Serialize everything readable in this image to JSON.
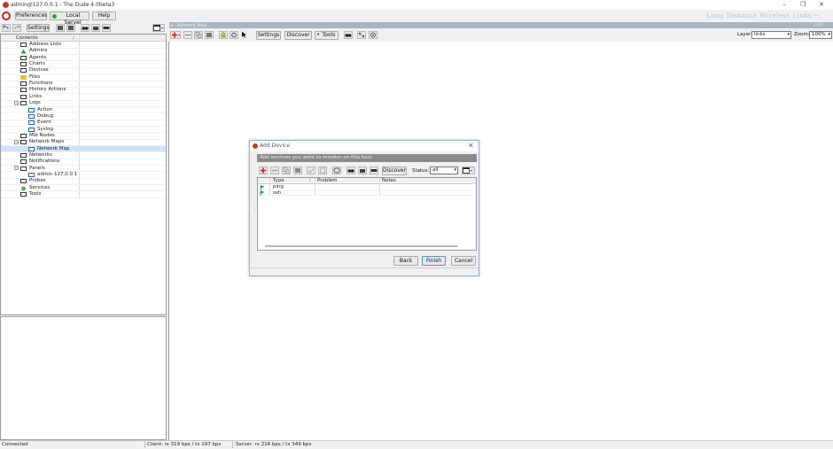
{
  "window": {
    "title": "admin@127.0.0.1 - The Dude 4.0beta3",
    "minimize_glyph": "–",
    "maximize_glyph": "❐",
    "close_glyph": "✕"
  },
  "topbar": {
    "preferences_label": "Preferences",
    "local_server_label": "Local Server",
    "help_label": "Help",
    "brand_text": "Long Distance Wireless Links →"
  },
  "left_toolbar": {
    "settings_label": "Settings"
  },
  "tree": {
    "header": "Contents",
    "items": [
      {
        "label": "Address Lists",
        "depth": 0,
        "icon": "list-icon",
        "toggle": ""
      },
      {
        "label": "Admins",
        "depth": 0,
        "icon": "admin-icon",
        "toggle": ""
      },
      {
        "label": "Agents",
        "depth": 0,
        "icon": "list-icon",
        "toggle": ""
      },
      {
        "label": "Charts",
        "depth": 0,
        "icon": "list-icon",
        "toggle": ""
      },
      {
        "label": "Devices",
        "depth": 0,
        "icon": "list-icon",
        "toggle": ""
      },
      {
        "label": "Files",
        "depth": 0,
        "icon": "folder-icon",
        "toggle": ""
      },
      {
        "label": "Functions",
        "depth": 0,
        "icon": "list-icon",
        "toggle": ""
      },
      {
        "label": "History Actions",
        "depth": 0,
        "icon": "list-icon",
        "toggle": ""
      },
      {
        "label": "Links",
        "depth": 0,
        "icon": "list-icon",
        "toggle": ""
      },
      {
        "label": "Logs",
        "depth": 0,
        "icon": "list-icon",
        "toggle": "−"
      },
      {
        "label": "Action",
        "depth": 1,
        "icon": "log-icon",
        "toggle": ""
      },
      {
        "label": "Debug",
        "depth": 1,
        "icon": "log-icon",
        "toggle": ""
      },
      {
        "label": "Event",
        "depth": 1,
        "icon": "log-icon",
        "toggle": ""
      },
      {
        "label": "Syslog",
        "depth": 1,
        "icon": "log-icon",
        "toggle": ""
      },
      {
        "label": "Mib Nodes",
        "depth": 0,
        "icon": "list-icon",
        "toggle": ""
      },
      {
        "label": "Network Maps",
        "depth": 0,
        "icon": "list-icon",
        "toggle": "−"
      },
      {
        "label": "Network Map",
        "depth": 1,
        "icon": "map-icon",
        "toggle": "",
        "selected": true
      },
      {
        "label": "Networks",
        "depth": 0,
        "icon": "list-icon",
        "toggle": ""
      },
      {
        "label": "Notifications",
        "depth": 0,
        "icon": "list-icon",
        "toggle": ""
      },
      {
        "label": "Panels",
        "depth": 0,
        "icon": "list-icon",
        "toggle": "−"
      },
      {
        "label": "admin 127.0.0.1",
        "depth": 1,
        "icon": "panel-icon",
        "toggle": ""
      },
      {
        "label": "Probes",
        "depth": 0,
        "icon": "list-icon",
        "toggle": ""
      },
      {
        "label": "Services",
        "depth": 0,
        "icon": "services-icon",
        "toggle": ""
      },
      {
        "label": "Tools",
        "depth": 0,
        "icon": "list-icon",
        "toggle": ""
      }
    ]
  },
  "map": {
    "tab_label": "Network Map",
    "settings_label": "Settings",
    "discover_label": "Discover",
    "tools_label": "Tools",
    "layer_label": "Layer:",
    "layer_value": "links",
    "zoom_label": "Zoom:",
    "zoom_value": "100%"
  },
  "dialog": {
    "title": "Add Device",
    "close_glyph": "✕",
    "banner": "Add services you want to monitor on this host",
    "discover_label": "Discover",
    "status_label": "Status:",
    "status_value": "all",
    "columns": [
      "Type",
      "Problem",
      "Notes"
    ],
    "rows": [
      {
        "type": "ping",
        "problem": "",
        "notes": ""
      },
      {
        "type": "ssh",
        "problem": "",
        "notes": ""
      }
    ],
    "back_label": "Back",
    "finish_label": "Finish",
    "cancel_label": "Cancel"
  },
  "statusbar": {
    "connection": "Connected",
    "client": "Client: rx 319 bps / tx 197 bps",
    "server": "Server: rx 216 bps / tx 349 bps"
  },
  "colors": {
    "selection": "#cfe3f7",
    "map_tab": "#a8b6c1",
    "brand_red": "#c23a2c",
    "add_red": "#d4161c",
    "status_green": "#2a9d3c"
  }
}
